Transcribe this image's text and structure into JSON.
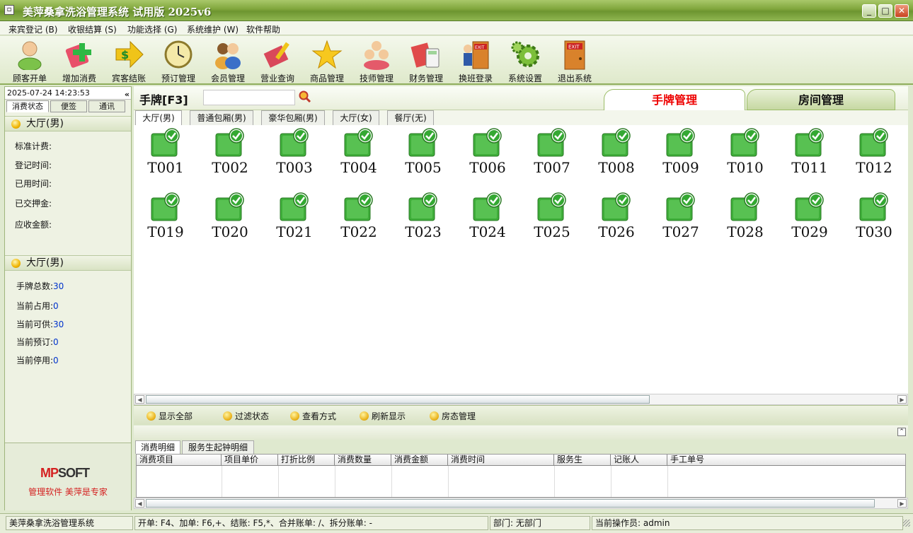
{
  "window": {
    "title": "美萍桑拿洗浴管理系统 试用版 2025v6"
  },
  "menu": [
    "来宾登记 (B)",
    "收银结算 (S)",
    "功能选择 (G)",
    "系统维护 (W)",
    "软件帮助"
  ],
  "toolbar": [
    {
      "label": "顾客开单",
      "icon": "customer-icon"
    },
    {
      "label": "增加消费",
      "icon": "add-consumption-icon"
    },
    {
      "label": "宾客结账",
      "icon": "checkout-icon"
    },
    {
      "label": "预订管理",
      "icon": "clock-icon"
    },
    {
      "label": "会员管理",
      "icon": "members-icon"
    },
    {
      "label": "营业查询",
      "icon": "query-icon"
    },
    {
      "label": "商品管理",
      "icon": "star-icon"
    },
    {
      "label": "技师管理",
      "icon": "technicians-icon"
    },
    {
      "label": "财务管理",
      "icon": "finance-icon"
    },
    {
      "label": "换班登录",
      "icon": "shift-exit-icon"
    },
    {
      "label": "系统设置",
      "icon": "gear-icon"
    },
    {
      "label": "退出系统",
      "icon": "exit-door-icon"
    }
  ],
  "left": {
    "datetime": "2025-07-24 14:23:53",
    "tabs": [
      "消费状态",
      "便签",
      "通讯"
    ],
    "group1": "大厅(男)",
    "fields1": [
      "标准计费:",
      "登记时间:",
      "已用时间:",
      "已交押金:",
      "应收金额:"
    ],
    "group2": "大厅(男)",
    "stats": [
      {
        "label": "手牌总数:",
        "value": "30"
      },
      {
        "label": "当前占用:",
        "value": "0"
      },
      {
        "label": "当前可供:",
        "value": "30"
      },
      {
        "label": "当前预订:",
        "value": "0"
      },
      {
        "label": "当前停用:",
        "value": "0"
      }
    ],
    "brand_logo_a": "MP",
    "brand_logo_b": "SOFT",
    "slogan": "管理软件   美萍是专家"
  },
  "main": {
    "tag_label": "手牌[F3]",
    "search_value": "",
    "view_tabs": [
      "手牌管理",
      "房间管理"
    ],
    "room_tabs": [
      "大厅(男)",
      "普通包厢(男)",
      "豪华包厢(男)",
      "大厅(女)",
      "餐厅(无)"
    ],
    "tags_row1": [
      "T001",
      "T002",
      "T003",
      "T004",
      "T005",
      "T006",
      "T007",
      "T008",
      "T009",
      "T010",
      "T011",
      "T012"
    ],
    "tags_row2": [
      "T019",
      "T020",
      "T021",
      "T022",
      "T023",
      "T024",
      "T025",
      "T026",
      "T027",
      "T028",
      "T029",
      "T030"
    ],
    "actions": [
      "显示全部",
      "过滤状态",
      "查看方式",
      "刷新显示",
      "房态管理"
    ],
    "detail_tabs": [
      "消费明细",
      "服务生起钟明细"
    ],
    "columns": [
      "消费项目",
      "项目单价",
      "打折比例",
      "消费数量",
      "消费金额",
      "消费时间",
      "服务生",
      "记账人",
      "手工单号"
    ]
  },
  "status": {
    "app": "美萍桑拿洗浴管理系统",
    "shortcuts": "开单: F4、加单: F6,+、结账: F5,*、合并账单: /、拆分账单: -",
    "dept": "部门: 无部门",
    "operator": "当前操作员: admin"
  },
  "colors": {
    "accent": "#7fa53b",
    "active_tab_text": "#e00000",
    "value_text": "#0033cc",
    "brand_red": "#d42020"
  }
}
